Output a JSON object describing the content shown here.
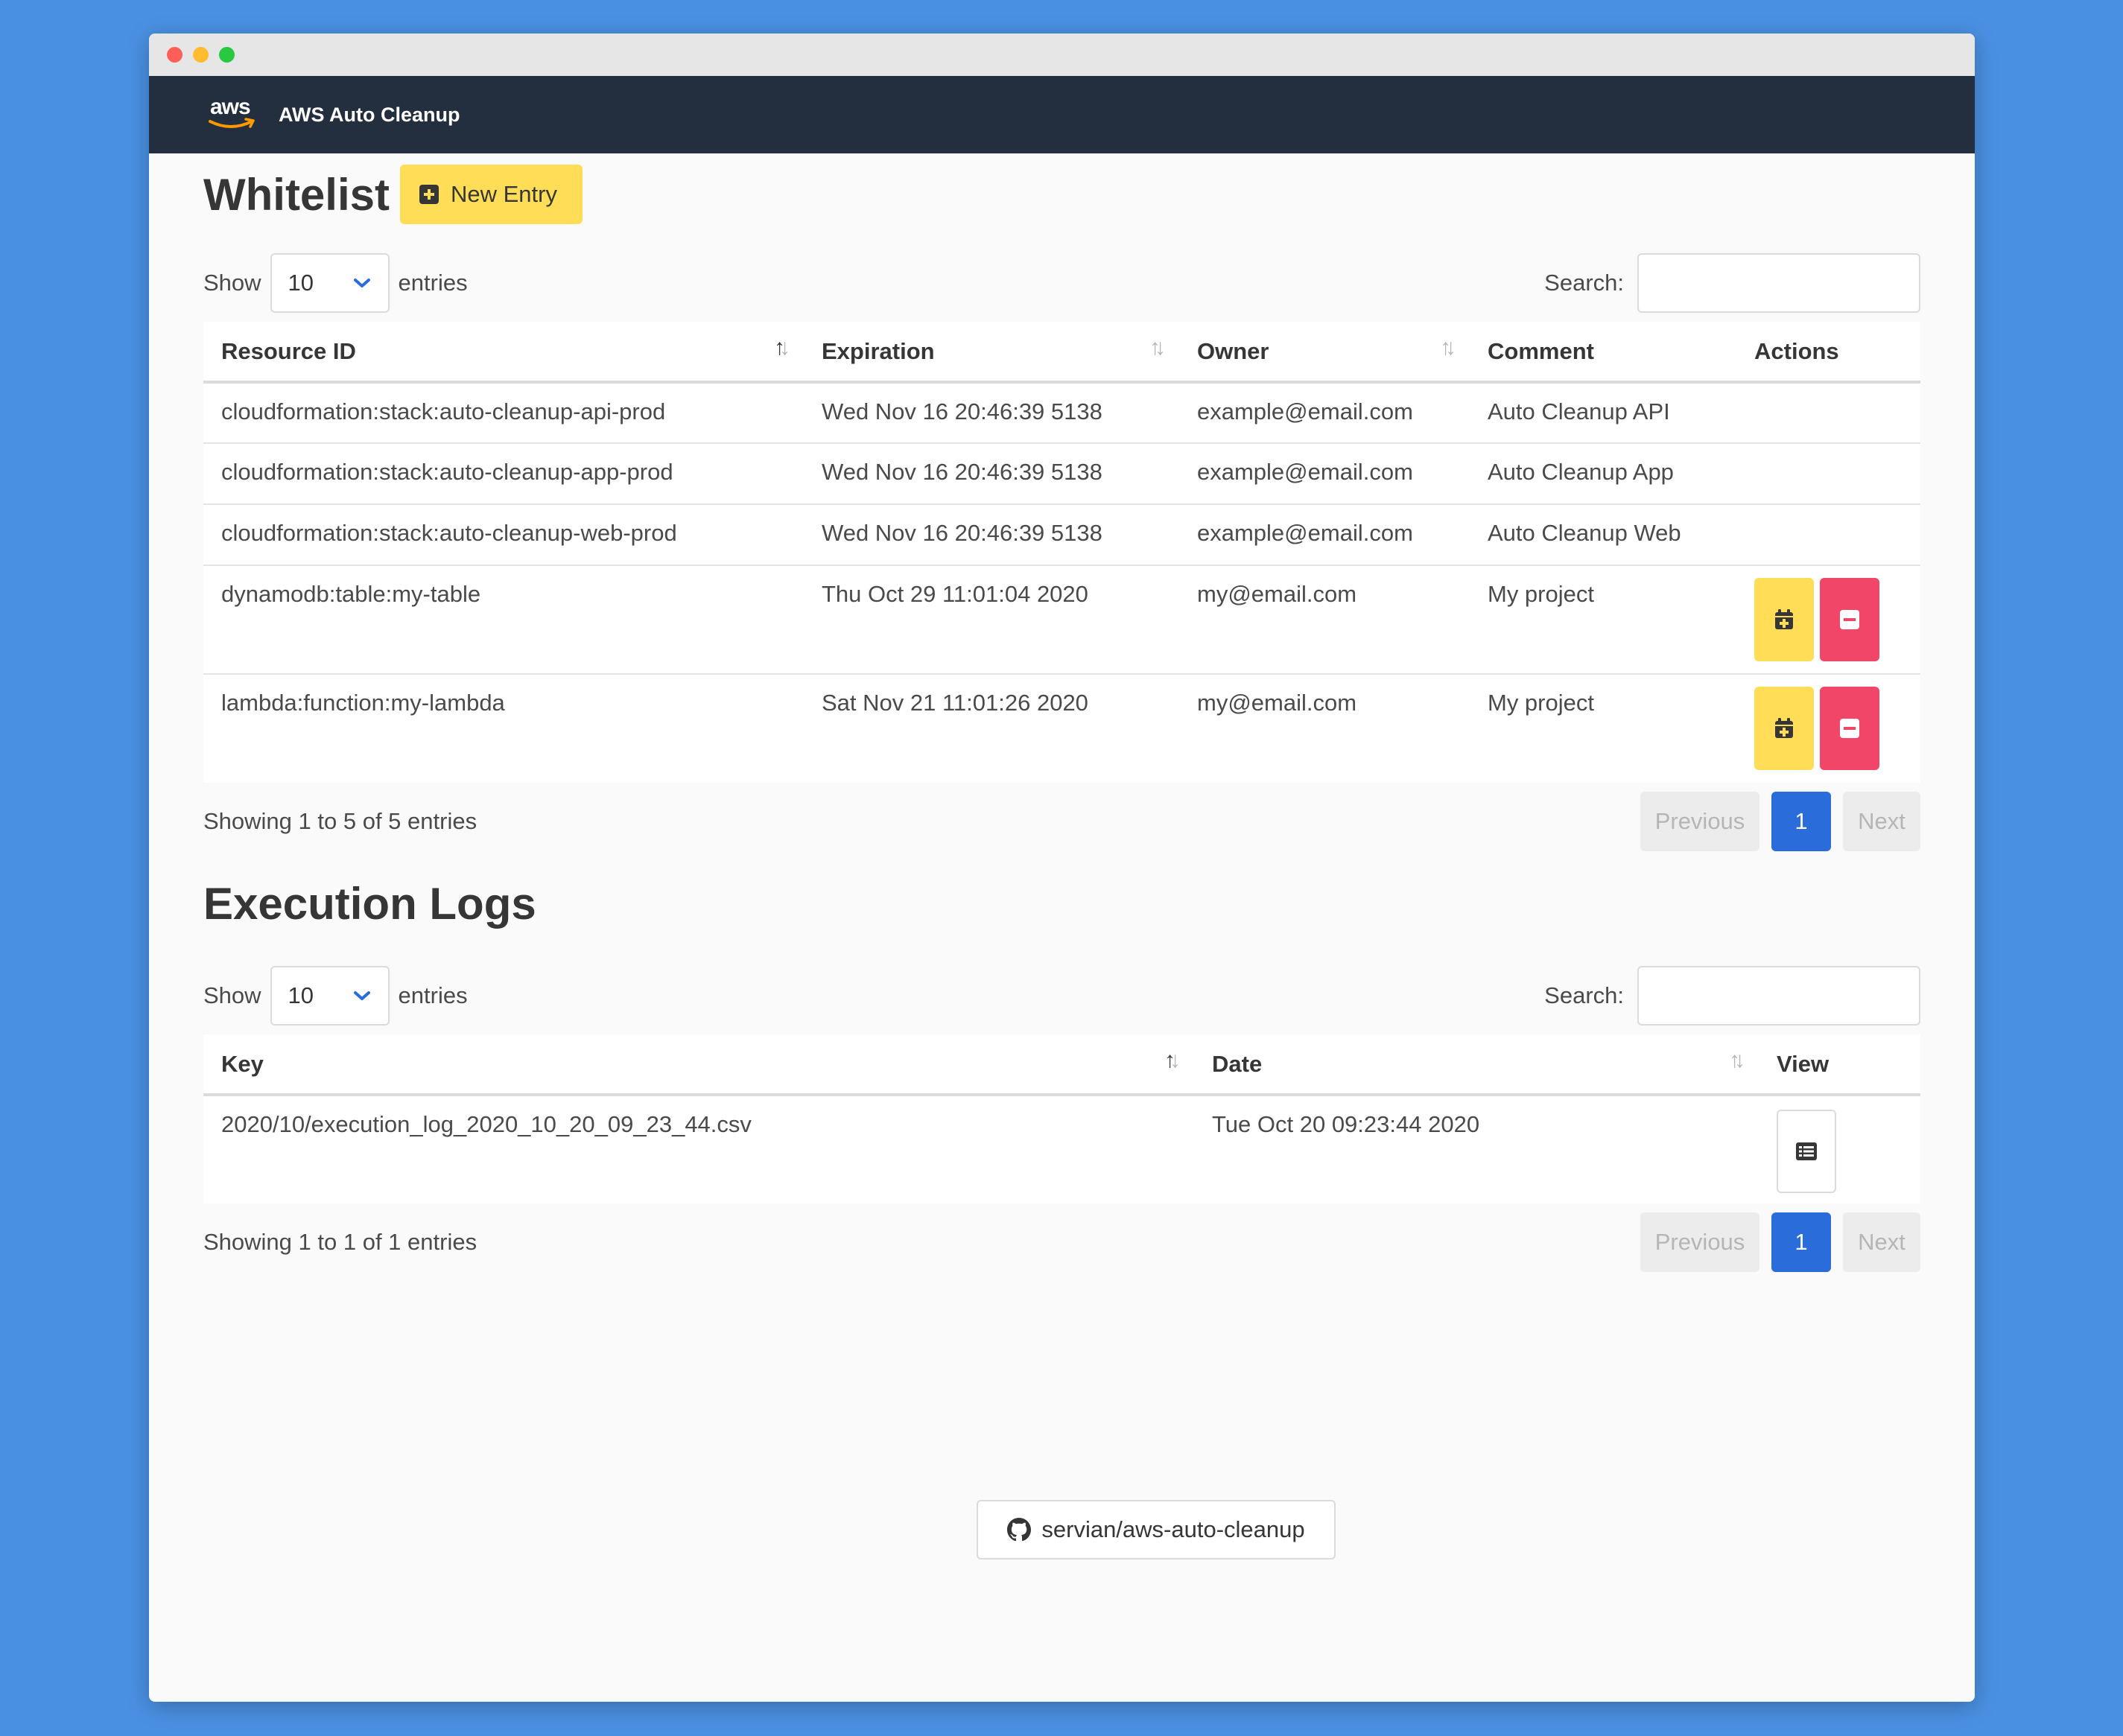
{
  "window": {
    "dots": [
      "#ff5f57",
      "#febc2e",
      "#28c840"
    ]
  },
  "navbar": {
    "logo_text": "aws",
    "title": "AWS Auto Cleanup"
  },
  "whitelist": {
    "title": "Whitelist",
    "new_entry_label": "New Entry",
    "show_label": "Show",
    "entries_label": "entries",
    "page_size": "10",
    "search_label": "Search:",
    "search_value": "",
    "columns": [
      "Resource ID",
      "Expiration",
      "Owner",
      "Comment",
      "Actions"
    ],
    "rows": [
      {
        "resource_id": "cloudformation:stack:auto-cleanup-api-prod",
        "expiration": "Wed Nov 16 20:46:39 5138",
        "owner": "example@email.com",
        "comment": "Auto Cleanup API"
      },
      {
        "resource_id": "cloudformation:stack:auto-cleanup-app-prod",
        "expiration": "Wed Nov 16 20:46:39 5138",
        "owner": "example@email.com",
        "comment": "Auto Cleanup App"
      },
      {
        "resource_id": "cloudformation:stack:auto-cleanup-web-prod",
        "expiration": "Wed Nov 16 20:46:39 5138",
        "owner": "example@email.com",
        "comment": "Auto Cleanup Web"
      },
      {
        "resource_id": "dynamodb:table:my-table",
        "expiration": "Thu Oct 29 11:01:04 2020",
        "owner": "my@email.com",
        "comment": "My project"
      },
      {
        "resource_id": "lambda:function:my-lambda",
        "expiration": "Sat Nov 21 11:01:26 2020",
        "owner": "my@email.com",
        "comment": "My project"
      }
    ],
    "info": "Showing 1 to 5 of 5 entries",
    "pager": {
      "previous": "Previous",
      "current": "1",
      "next": "Next"
    }
  },
  "logs": {
    "title": "Execution Logs",
    "show_label": "Show",
    "entries_label": "entries",
    "page_size": "10",
    "search_label": "Search:",
    "search_value": "",
    "columns": [
      "Key",
      "Date",
      "View"
    ],
    "rows": [
      {
        "key": "2020/10/execution_log_2020_10_20_09_23_44.csv",
        "date": "Tue Oct 20 09:23:44 2020"
      }
    ],
    "info": "Showing 1 to 1 of 1 entries",
    "pager": {
      "previous": "Previous",
      "current": "1",
      "next": "Next"
    }
  },
  "footer": {
    "github_label": "servian/aws-auto-cleanup"
  },
  "colors": {
    "background": "#4a90e2",
    "navbar": "#232f3e",
    "warning": "#ffdd57",
    "danger": "#f14668",
    "primary": "#2b6cdb",
    "aws_orange": "#ff9900"
  },
  "icons": {
    "new_entry": "plus-square-icon",
    "dropdown": "chevron-down-icon",
    "extend": "calendar-plus-icon",
    "delete": "minus-square-icon",
    "view": "list-icon",
    "github": "github-icon"
  }
}
